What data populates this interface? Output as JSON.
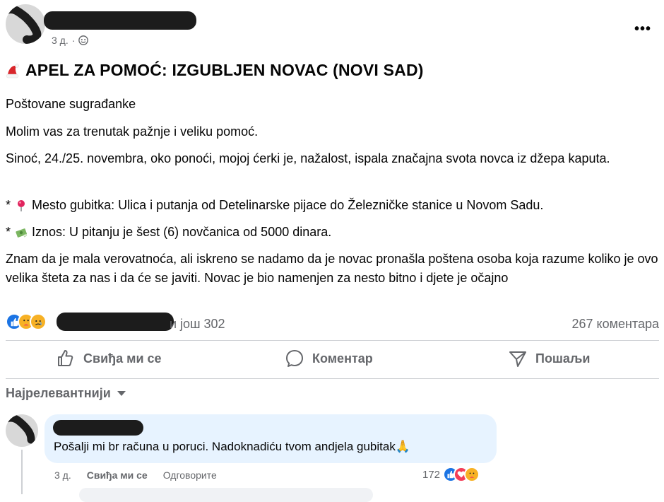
{
  "post": {
    "time": "3 д.",
    "separator": "·",
    "more_label": "•••",
    "title": "APEL ZA POMOĆ: IZGUBLJEN NOVAC (NOVI SAD)",
    "paragraphs": {
      "p1": "Poštovane sugrađanke",
      "p2": "Molim vas za trenutak pažnje i veliku pomoć.",
      "p3": "Sinoć, 24./25. novembra, oko ponoći, mojoj ćerki je, nažalost, ispala značajna svota novca iz džepa kaputa.",
      "bullet_star": "*",
      "b1": "Mesto gubitka: Ulica i putanja od Detelinarske pijace do Železničke stanice u Novom Sadu.",
      "b2": "Iznos: U pitanju je šest (6) novčanica od 5000 dinara.",
      "p4": "Znam da je mala verovatnoća, ali iskreno se nadamo da je novac pronašla poštena osoba koja razume koliko je ovo velika šteta za nas i da će se javiti. Novac je bio namenjen za nesto bitno i djete je očajno"
    },
    "reactions_text": "и још 302",
    "comments_count": "267 коментара"
  },
  "actions": {
    "like": "Свиђа ми се",
    "comment": "Коментар",
    "share": "Пошаљи"
  },
  "sort": {
    "label": "Најрелевантнији"
  },
  "comment": {
    "text": "Pošalji mi br računa u poruci. Nadoknadiću tvom andjela gubitak",
    "emoji": "🙏",
    "time": "3 д.",
    "like": "Свиђа ми се",
    "reply": "Одговорите",
    "reaction_count": "172"
  },
  "colors": {
    "accent": "#1b74e4",
    "secondary_text": "#65676b",
    "comment_bubble": "#e7f3ff",
    "divider": "#ced0d4"
  },
  "icons": [
    "globe-icon",
    "santa-hat-icon",
    "pin-icon",
    "money-icon",
    "like-icon",
    "comment-icon",
    "share-icon",
    "caret-down-icon"
  ]
}
